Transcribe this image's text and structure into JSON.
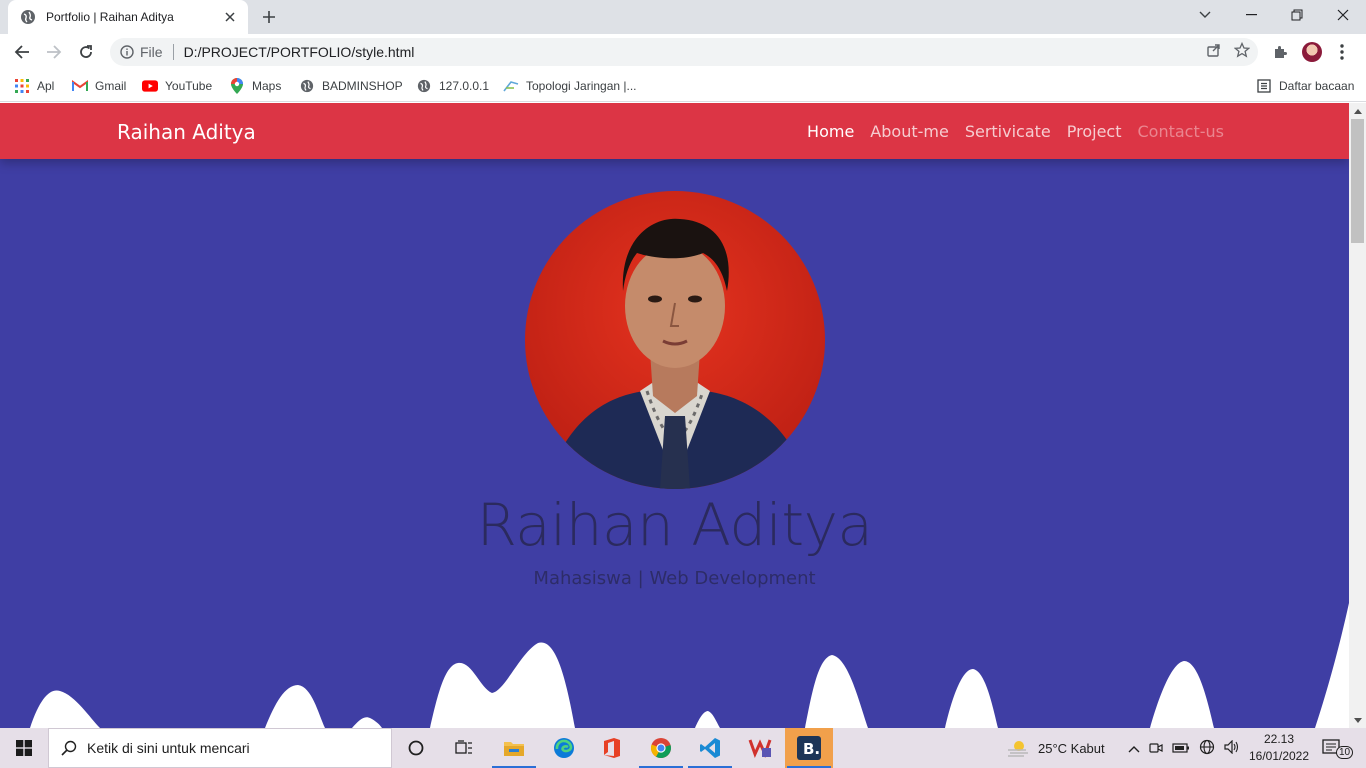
{
  "browser": {
    "tab_title": "Portfolio | Raihan Aditya",
    "url_scheme_label": "File",
    "url": "D:/PROJECT/PORTFOLIO/style.html",
    "bookmarks": [
      "Apl",
      "Gmail",
      "YouTube",
      "Maps",
      "BADMINSHOP",
      "127.0.0.1",
      "Topologi Jaringan |..."
    ],
    "reading_list": "Daftar bacaan"
  },
  "page": {
    "brand": "Raihan Aditya",
    "nav": [
      {
        "label": "Home",
        "state": "active"
      },
      {
        "label": "About-me",
        "state": "normal"
      },
      {
        "label": "Sertivicate",
        "state": "normal"
      },
      {
        "label": "Project",
        "state": "normal"
      },
      {
        "label": "Contact-us",
        "state": "faded"
      }
    ],
    "hero": {
      "name": "Raihan Aditya",
      "subtitle": "Mahasiswa | Web Development"
    },
    "colors": {
      "navbar": "#dc3545",
      "hero_bg": "#3f3ea4",
      "hero_text": "#2b2a5e",
      "wave": "#ffffff"
    }
  },
  "taskbar": {
    "search_placeholder": "Ketik di sini untuk mencari",
    "weather": "25°C  Kabut",
    "time": "22.13",
    "date": "16/01/2022",
    "notifications": "10"
  }
}
